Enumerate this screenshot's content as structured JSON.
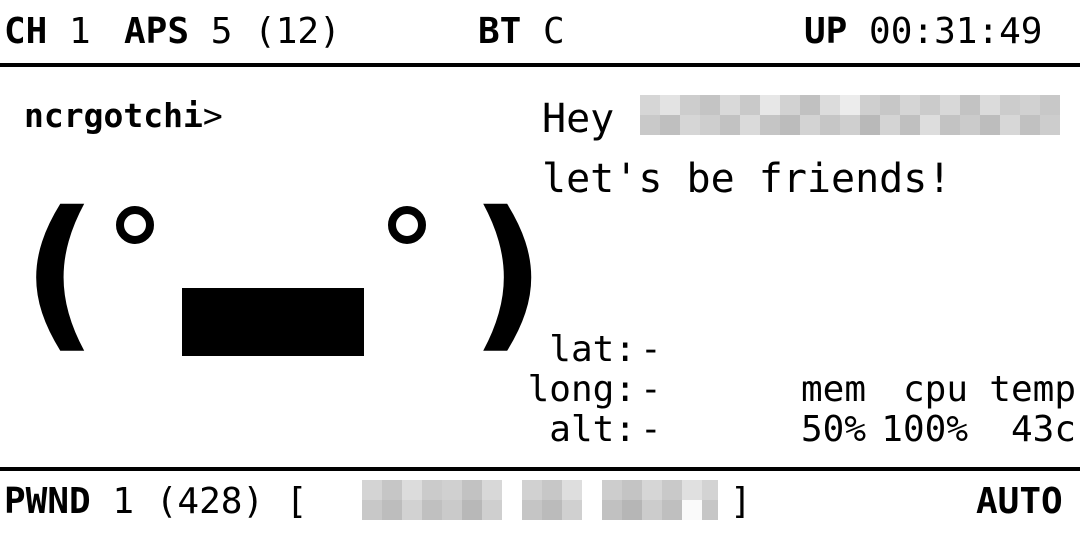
{
  "top_bar": {
    "ch_label": "CH",
    "ch_value": "1",
    "aps_label": "APS",
    "aps_value": "5 (12)",
    "bt_label": "BT",
    "bt_value": "C",
    "up_label": "UP",
    "up_value": "00:31:49"
  },
  "name": {
    "label": "ncrgotchi",
    "prompt": ">"
  },
  "face": {
    "left_paren": "(",
    "right_paren": ")"
  },
  "speech": {
    "greeting": "Hey",
    "message": "let's be friends!"
  },
  "gps": {
    "lat_label": "lat:",
    "lat_value": "-",
    "long_label": "long:",
    "long_value": "-",
    "alt_label": "alt:",
    "alt_value": "-"
  },
  "stats": {
    "mem_label": "mem",
    "cpu_label": "cpu",
    "temp_label": "temp",
    "mem_value": "50%",
    "cpu_value": "100%",
    "temp_value": "43c"
  },
  "bottom_bar": {
    "pwnd_label": "PWND",
    "pwnd_value": "1 (428)",
    "bracket_open": "[",
    "bracket_close": "]",
    "mode": "AUTO"
  }
}
